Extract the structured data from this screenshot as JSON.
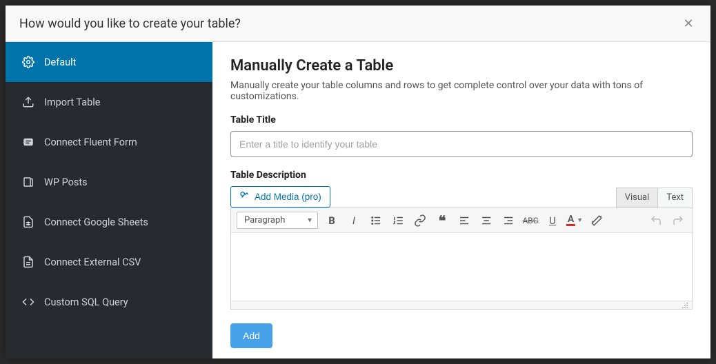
{
  "modal": {
    "title": "How would you like to create your table?"
  },
  "sidebar": {
    "items": [
      {
        "label": "Default"
      },
      {
        "label": "Import Table"
      },
      {
        "label": "Connect Fluent Form"
      },
      {
        "label": "WP Posts"
      },
      {
        "label": "Connect Google Sheets"
      },
      {
        "label": "Connect External CSV"
      },
      {
        "label": "Custom SQL Query"
      }
    ]
  },
  "content": {
    "heading": "Manually Create a Table",
    "description": "Manually create your table columns and rows to get complete control over your data with tons of customizations.",
    "title_label": "Table Title",
    "title_placeholder": "Enter a title to identify your table",
    "desc_label": "Table Description",
    "add_media_label": "Add Media (pro)",
    "tabs": {
      "visual": "Visual",
      "text": "Text"
    },
    "toolbar": {
      "format": "Paragraph"
    },
    "add_button": "Add"
  }
}
